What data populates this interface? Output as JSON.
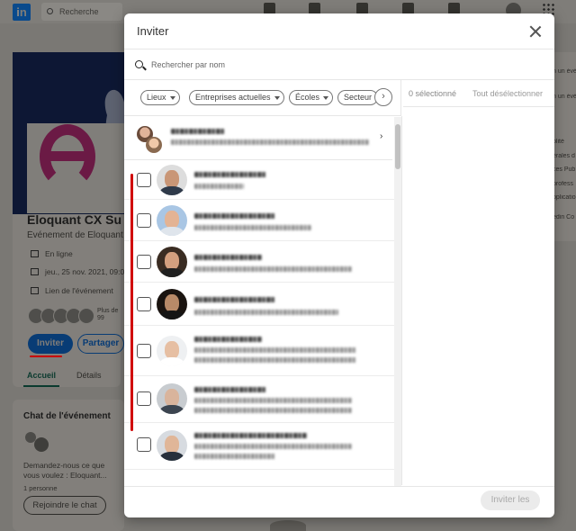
{
  "background": {
    "nav": {
      "search_placeholder": "Recherche"
    },
    "event": {
      "title": "Eloquant CX Su",
      "subtitle": "Événement de Eloquant",
      "location": "En ligne",
      "date": "jeu., 25 nov. 2021, 09:0",
      "link": "Lien de l'événement",
      "attendees_more": "Plus de 99",
      "invite_button": "Inviter",
      "share_button": "Partager",
      "tabs": [
        "Accueil",
        "Détails"
      ]
    },
    "chat": {
      "title": "Chat de l'événement",
      "description": "Demandez-nous ce que vous voulez : Eloquant...",
      "count": "1 personne",
      "join_button": "Rejoindre le chat"
    },
    "right_snippets": [
      "n un événe",
      "olité",
      "érales d",
      "ces Pub",
      "profess",
      "pplicatio",
      "edin Co"
    ]
  },
  "modal": {
    "title": "Inviter",
    "search_placeholder": "Rechercher par nom",
    "filters": [
      "Lieux",
      "Entreprises actuelles",
      "Écoles",
      "Secteur"
    ],
    "next_filter_icon": "chevron-right-icon",
    "selected_count": "0 sélectionné",
    "clear_all": "Tout désélectionner",
    "send_button": "Inviter les"
  },
  "colors": {
    "linkedin_blue": "#0a66c2",
    "annotation_red": "#d00000",
    "brand_magenta": "#c0247a"
  }
}
